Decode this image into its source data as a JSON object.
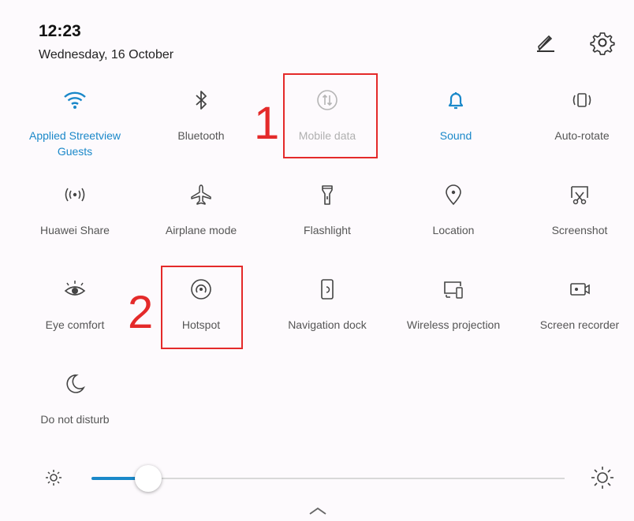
{
  "status": {
    "time": "12:23",
    "date": "Wednesday, 16 October"
  },
  "header_icons": {
    "edit": "edit-pencil-icon",
    "settings": "gear-icon"
  },
  "colors": {
    "accent": "#1a88c9",
    "annotation": "#e42a2a",
    "inactive_label": "#555555",
    "disabled_label": "#b0b0b0"
  },
  "tiles": [
    {
      "label": "Applied Streetview Guests",
      "icon": "wifi-icon",
      "state": "on"
    },
    {
      "label": "Bluetooth",
      "icon": "bluetooth-icon",
      "state": "off"
    },
    {
      "label": "Mobile data",
      "icon": "mobile-data-icon",
      "state": "disabled"
    },
    {
      "label": "Sound",
      "icon": "bell-icon",
      "state": "on"
    },
    {
      "label": "Auto-rotate",
      "icon": "auto-rotate-icon",
      "state": "off"
    },
    {
      "label": "Huawei Share",
      "icon": "huawei-share-icon",
      "state": "off"
    },
    {
      "label": "Airplane mode",
      "icon": "airplane-icon",
      "state": "off"
    },
    {
      "label": "Flashlight",
      "icon": "flashlight-icon",
      "state": "off"
    },
    {
      "label": "Location",
      "icon": "location-pin-icon",
      "state": "off"
    },
    {
      "label": "Screenshot",
      "icon": "screenshot-icon",
      "state": "off"
    },
    {
      "label": "Eye comfort",
      "icon": "eye-icon",
      "state": "off"
    },
    {
      "label": "Hotspot",
      "icon": "hotspot-icon",
      "state": "off"
    },
    {
      "label": "Navigation dock",
      "icon": "navigation-dock-icon",
      "state": "off"
    },
    {
      "label": "Wireless projection",
      "icon": "wireless-projection-icon",
      "state": "off"
    },
    {
      "label": "Screen recorder",
      "icon": "screen-recorder-icon",
      "state": "off"
    },
    {
      "label": "Do not disturb",
      "icon": "moon-icon",
      "state": "off"
    }
  ],
  "annotations": [
    {
      "number": "1",
      "target": "Mobile data"
    },
    {
      "number": "2",
      "target": "Hotspot"
    }
  ],
  "brightness": {
    "level": 0.12,
    "low_icon": "sun-small-icon",
    "high_icon": "sun-large-icon"
  },
  "expand_handle": "chevron-up-icon"
}
